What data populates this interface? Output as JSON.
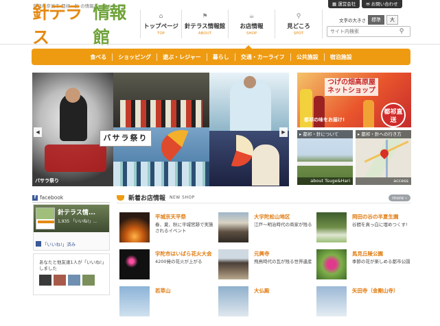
{
  "header": {
    "tagline": "奈良県奈良市 都祁・針 の情報ポータルサイト",
    "logo_part1": "針テラス",
    "logo_part2": "情報館",
    "topbar": {
      "company": "運営会社",
      "contact": "お問い合わせ"
    },
    "fontsize": {
      "label": "文字の大きさ",
      "standard": "標準",
      "large": "大"
    },
    "search": {
      "placeholder": "サイト内検索"
    },
    "nav": [
      {
        "jp": "トップページ",
        "en": "TOP",
        "icon": "home-icon"
      },
      {
        "jp": "針テラス情報館",
        "en": "ABOUT",
        "icon": "flag-icon"
      },
      {
        "jp": "お店情報",
        "en": "SHOP",
        "icon": "cup-icon"
      },
      {
        "jp": "見どころ",
        "en": "SPOT",
        "icon": "pin-icon"
      }
    ]
  },
  "categories": [
    "食べる",
    "ショッピング",
    "遊ぶ・レジャー",
    "暮らし",
    "交通・カーライフ",
    "公共施設",
    "宿泊施設"
  ],
  "slider": {
    "title": "バサラ祭り",
    "caption": "バサラ祭り"
  },
  "banner": {
    "title_line1": "つげの畑高原屋",
    "title_line2": "ネットショップ",
    "subtitle": "都祁の味をお届け!",
    "badge": "都祁直送"
  },
  "tiles": [
    {
      "header": "都祁・針について",
      "footer": "about Tsuge&Hari"
    },
    {
      "header": "都祁・針への行き方",
      "footer": "access"
    }
  ],
  "facebook": {
    "header": "facebook",
    "page_name": "針テラス情...",
    "likes": "1,935 「いいね!」...",
    "like_button": "「いいね!」済み",
    "feed_text": "あなたと他友達1人が「いいね!」しました"
  },
  "newshop": {
    "title": "新着お店情報",
    "subtitle": "NEW SHOP",
    "more": "more",
    "items": [
      {
        "name": "平城京天平祭",
        "desc": "春、夏、秋に平城宮跡で実施されるイベント"
      },
      {
        "name": "大宇陀松山地区",
        "desc": "江戸～明治時代の商家が残る"
      },
      {
        "name": "岡田の谷の半夏生園",
        "desc": "谷間を真っ白に埋めつくす!"
      },
      {
        "name": "宇陀市はいばら花火大会",
        "desc": "4200発の花火が上がる"
      },
      {
        "name": "元興寺",
        "desc": "飛鳥時代の瓦が残る世界遺産"
      },
      {
        "name": "馬見丘陵公園",
        "desc": "季節の花が楽しめる都市公園"
      },
      {
        "name": "若草山",
        "desc": ""
      },
      {
        "name": "大仏殿",
        "desc": ""
      },
      {
        "name": "矢田寺（金剛山寺）",
        "desc": ""
      }
    ]
  }
}
